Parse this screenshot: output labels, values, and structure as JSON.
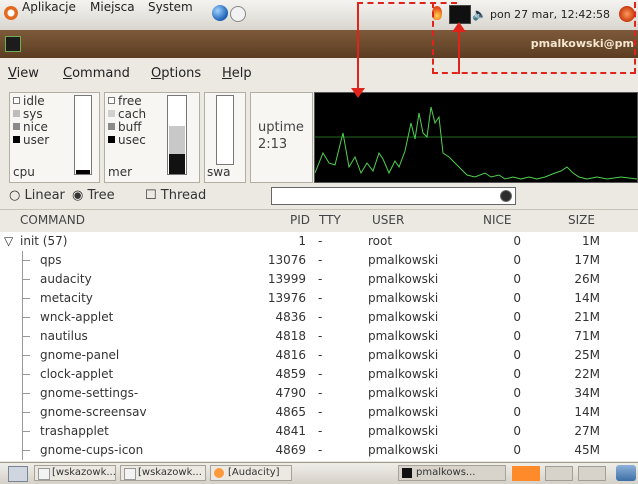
{
  "top_panel": {
    "menus": [
      "Aplikacje",
      "Miejsca",
      "System"
    ],
    "clock": "pon 27 mar, 12:42:58",
    "icons": [
      "distro-logo",
      "globe-icon",
      "email-icon",
      "flame-icon",
      "monitor-icon",
      "volume-icon",
      "shutdown-icon"
    ]
  },
  "window": {
    "title": "pmalkowski@pm"
  },
  "menubar": {
    "view": {
      "u": "V",
      "rest": "iew"
    },
    "command": {
      "u": "C",
      "rest": "ommand"
    },
    "options": {
      "u": "O",
      "rest": "ptions"
    },
    "help": {
      "u": "H",
      "rest": "elp"
    }
  },
  "cpu_meter": {
    "legend": [
      "idle",
      "sys",
      "nice",
      "user"
    ],
    "label": "cpu",
    "colors": {
      "idle": "#ffffff",
      "sys": "#bdbdbd",
      "nice": "#8a8a8a",
      "user": "#000000"
    }
  },
  "mem_meter": {
    "legend": [
      "free",
      "cach",
      "buff",
      "usec"
    ],
    "label": "mer"
  },
  "swap_meter": {
    "label": "swa"
  },
  "uptime": {
    "label": "uptime",
    "value": "2:13"
  },
  "options_row": {
    "linear": "Linear",
    "tree": "Tree",
    "thread": "Thread",
    "view_mode": "Tree"
  },
  "table": {
    "columns": [
      "COMMAND",
      "PID",
      "TTY",
      "USER",
      "NICE",
      "SIZE"
    ],
    "rows": [
      {
        "command": "init (57)",
        "pid": "1",
        "tty": "-",
        "user": "root",
        "nice": "0",
        "size": "1M"
      },
      {
        "command": "qps",
        "pid": "13076",
        "tty": "-",
        "user": "pmalkowski",
        "nice": "0",
        "size": "17M"
      },
      {
        "command": "audacity",
        "pid": "13999",
        "tty": "-",
        "user": "pmalkowski",
        "nice": "0",
        "size": "26M"
      },
      {
        "command": "metacity",
        "pid": "13976",
        "tty": "-",
        "user": "pmalkowski",
        "nice": "0",
        "size": "14M"
      },
      {
        "command": "wnck-applet",
        "pid": "4836",
        "tty": "-",
        "user": "pmalkowski",
        "nice": "0",
        "size": "21M"
      },
      {
        "command": "nautilus",
        "pid": "4818",
        "tty": "-",
        "user": "pmalkowski",
        "nice": "0",
        "size": "71M"
      },
      {
        "command": "gnome-panel",
        "pid": "4816",
        "tty": "-",
        "user": "pmalkowski",
        "nice": "0",
        "size": "25M"
      },
      {
        "command": "clock-applet",
        "pid": "4859",
        "tty": "-",
        "user": "pmalkowski",
        "nice": "0",
        "size": "22M"
      },
      {
        "command": "gnome-settings-",
        "pid": "4790",
        "tty": "-",
        "user": "pmalkowski",
        "nice": "0",
        "size": "34M"
      },
      {
        "command": "gnome-screensav",
        "pid": "4865",
        "tty": "-",
        "user": "pmalkowski",
        "nice": "0",
        "size": "14M"
      },
      {
        "command": "trashapplet",
        "pid": "4841",
        "tty": "-",
        "user": "pmalkowski",
        "nice": "0",
        "size": "27M"
      },
      {
        "command": "gnome-cups-icon",
        "pid": "4869",
        "tty": "-",
        "user": "pmalkowski",
        "nice": "0",
        "size": "45M"
      }
    ]
  },
  "taskbar": {
    "items": [
      "[wskazowk...",
      "[wskazowk...",
      "[Audacity]",
      "pmalkows..."
    ]
  }
}
